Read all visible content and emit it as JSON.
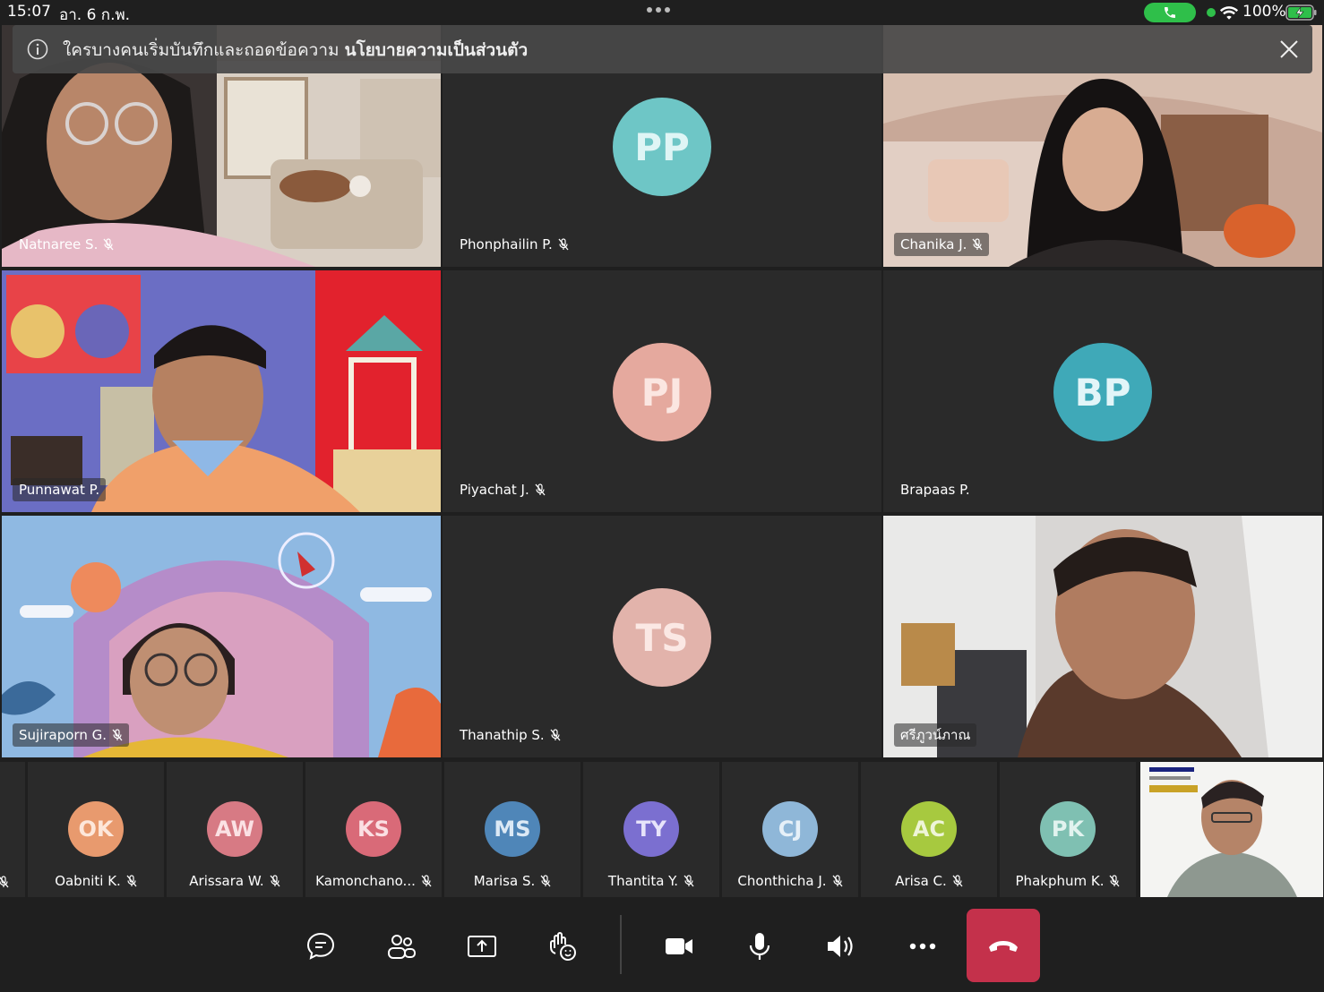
{
  "status_bar": {
    "time": "15:07",
    "date": "อา. 6 ก.พ.",
    "battery": "100%"
  },
  "banner": {
    "message": "ใครบางคนเริ่มบันทึกและถอดข้อความ",
    "link": "นโยบายความเป็นส่วนตัว"
  },
  "tiles": [
    {
      "name": "Natnaree S.",
      "type": "video",
      "muted": true
    },
    {
      "name": "Phonphailin P.",
      "initials": "PP",
      "avatar_color": "#6ec6c6",
      "initials_color": "#dff5f5",
      "muted": true
    },
    {
      "name": "Chanika J.",
      "type": "video",
      "muted": true
    },
    {
      "name": "Punnawat P.",
      "type": "video",
      "muted": false,
      "active": true
    },
    {
      "name": "Piyachat J.",
      "initials": "PJ",
      "avatar_color": "#e5a99e",
      "initials_color": "#fbe6e1",
      "muted": true
    },
    {
      "name": "Brapaas P.",
      "initials": "BP",
      "avatar_color": "#3fa9b8",
      "initials_color": "#e2f5f8",
      "muted": false
    },
    {
      "name": "Sujiraporn G.",
      "type": "video",
      "muted": true
    },
    {
      "name": "Thanathip S.",
      "initials": "TS",
      "avatar_color": "#e2b3ab",
      "initials_color": "#fbe8e4",
      "muted": true
    },
    {
      "name": "ศรีภูวน์ภาณ",
      "type": "video",
      "muted": false
    }
  ],
  "strip": [
    {
      "name": "Oabniti K.",
      "initials": "OK",
      "avatar_color": "#e89a6e",
      "initials_color": "#fde7da"
    },
    {
      "name": "Arissara W.",
      "initials": "AW",
      "avatar_color": "#d77a84",
      "initials_color": "#fbe1e4"
    },
    {
      "name": "Kamonchano...",
      "initials": "KS",
      "avatar_color": "#d96a78",
      "initials_color": "#fbdfe3"
    },
    {
      "name": "Marisa S.",
      "initials": "MS",
      "avatar_color": "#4f86b8",
      "initials_color": "#dce9f5"
    },
    {
      "name": "Thantita Y.",
      "initials": "TY",
      "avatar_color": "#7b6fd0",
      "initials_color": "#e7e4fa"
    },
    {
      "name": "Chonthicha J.",
      "initials": "CJ",
      "avatar_color": "#8fb7d8",
      "initials_color": "#e6f0f8"
    },
    {
      "name": "Arisa C.",
      "initials": "AC",
      "avatar_color": "#a7c93f",
      "initials_color": "#eef5d7"
    },
    {
      "name": "Phakphum K.",
      "initials": "PK",
      "avatar_color": "#7fc0b2",
      "initials_color": "#e2f3ef"
    }
  ],
  "toolbar": {
    "icons": [
      "chat-icon",
      "participants-icon",
      "share-icon",
      "reactions-icon",
      "camera-icon",
      "microphone-icon",
      "speaker-icon",
      "more-icon",
      "hang-up-icon"
    ]
  }
}
